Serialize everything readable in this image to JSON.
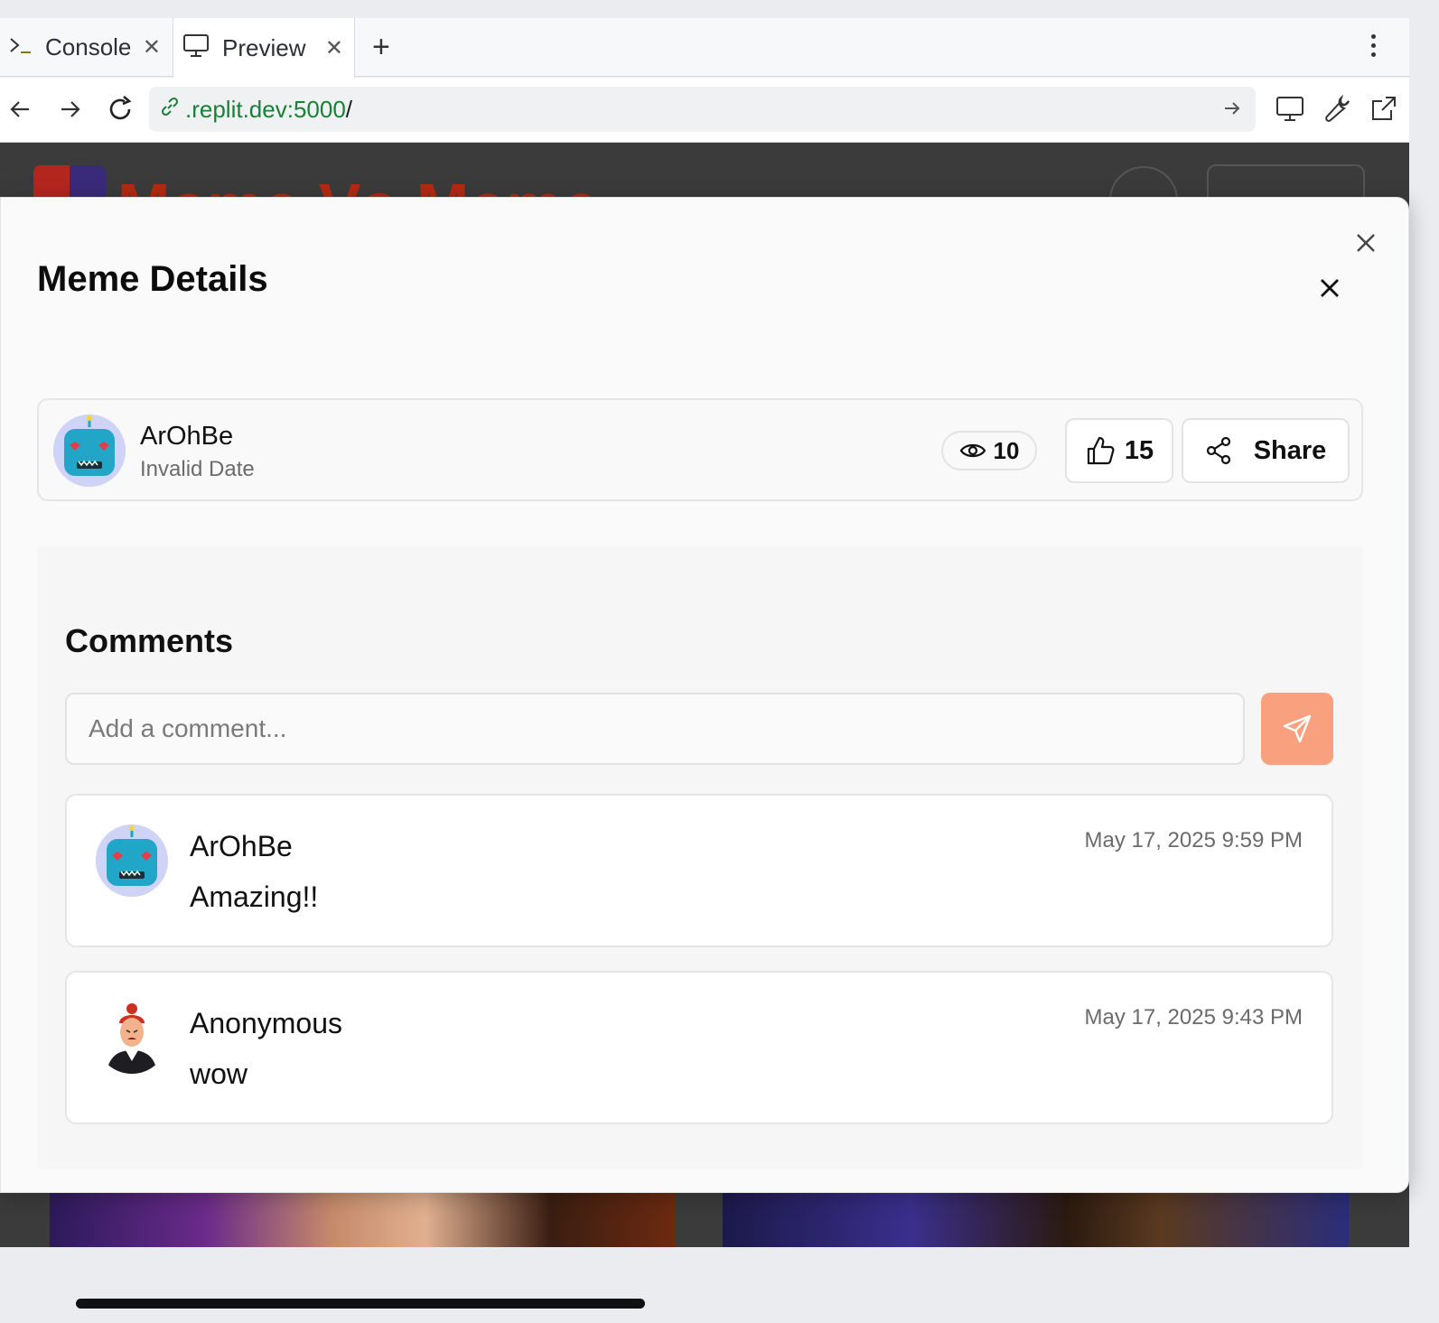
{
  "browser": {
    "tabs": [
      {
        "label": "Console",
        "icon": "terminal-icon"
      },
      {
        "label": "Preview",
        "icon": "monitor-icon"
      }
    ],
    "url": {
      "domain": ".replit.dev:5000",
      "path": "/"
    }
  },
  "background_page": {
    "site_title": "Meme Vs Meme"
  },
  "modal": {
    "title": "Meme Details",
    "meme": {
      "author": "ArOhBe",
      "date": "Invalid Date",
      "views": "10",
      "likes": "15",
      "share_label": "Share"
    },
    "comments": {
      "title": "Comments",
      "input_placeholder": "Add a comment...",
      "items": [
        {
          "author": "ArOhBe",
          "text": "Amazing!!",
          "time": "May 17, 2025 9:59 PM",
          "avatar": "robot-avatar"
        },
        {
          "author": "Anonymous",
          "text": "wow",
          "time": "May 17, 2025 9:43 PM",
          "avatar": "person-avatar"
        }
      ]
    }
  },
  "colors": {
    "accent": "#f9a07e",
    "url_domain": "#1a7f37",
    "site_title": "#b42a12",
    "avatar_bg": "#cfd3f5"
  }
}
